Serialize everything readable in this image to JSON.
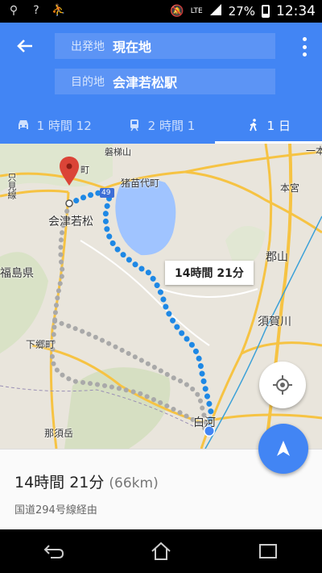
{
  "status": {
    "network": "LTE",
    "battery": "27%",
    "time": "12:34"
  },
  "route": {
    "from_label": "出発地",
    "from_value": "現在地",
    "to_label": "目的地",
    "to_value": "会津若松駅"
  },
  "tabs": [
    {
      "icon": "car-icon",
      "label": "1 時間 12"
    },
    {
      "icon": "train-icon",
      "label": "2 時間 1"
    },
    {
      "icon": "walk-icon",
      "label": "1 日"
    }
  ],
  "map": {
    "places": {
      "aizu": "会津若松",
      "inawashiro": "猪苗代町",
      "motomiya": "本宮",
      "koriyama": "郡山",
      "sukagawa": "須賀川",
      "shirakawa": "白河",
      "shimogo": "下郷町",
      "nasudake": "那須岳",
      "fukushima": "福島県",
      "tadami": "只見線",
      "bandai": "磐梯山",
      "ichinohe": "一本",
      "machi": "町"
    },
    "route_shield": "49",
    "time_label": "14時間 21分"
  },
  "summary": {
    "time": "14時間 21分",
    "distance": "(66km)",
    "via": "国道294号線経由"
  }
}
